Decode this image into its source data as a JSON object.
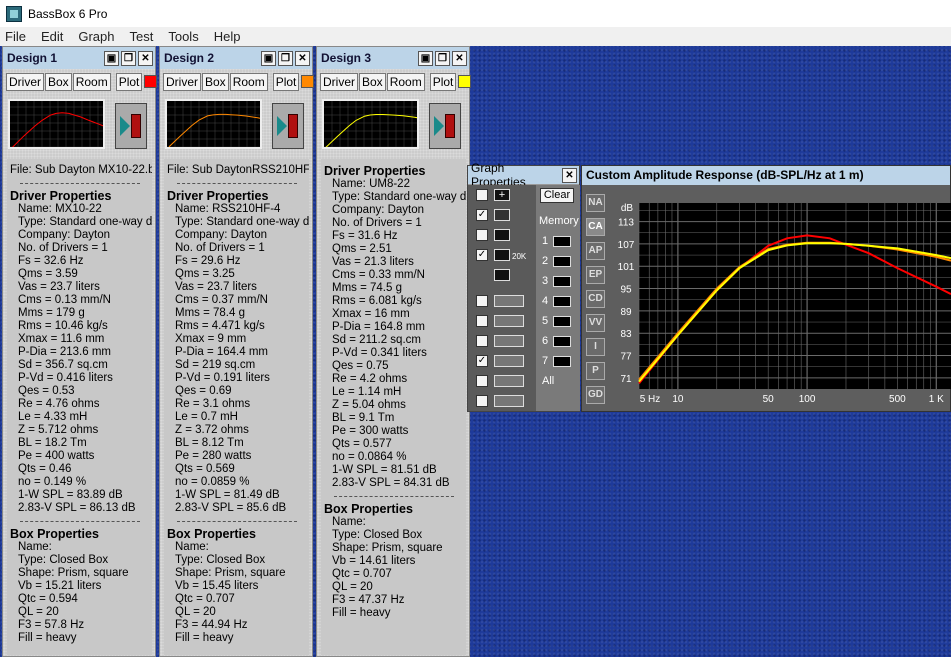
{
  "app": {
    "title": "BassBox 6 Pro"
  },
  "menu": [
    "File",
    "Edit",
    "Graph",
    "Test",
    "Tools",
    "Help"
  ],
  "tabs": {
    "driver": "Driver",
    "box": "Box",
    "room": "Room",
    "plot": "Plot"
  },
  "designs": [
    {
      "title": "Design 1",
      "color": "#ff0000",
      "file": "File: Sub Dayton MX10-22.bb6",
      "driver_heading": "Driver Properties",
      "driver": [
        "Name: MX10-22",
        "Type: Standard one-way driver",
        "Company: Dayton",
        "No. of Drivers = 1",
        "Fs = 32.6 Hz",
        "Qms = 3.59",
        "Vas = 23.7 liters",
        "Cms = 0.13 mm/N",
        "Mms = 179 g",
        "Rms = 10.46 kg/s",
        "Xmax = 11.6 mm",
        "P-Dia = 213.6 mm",
        "Sd = 356.7 sq.cm",
        "P-Vd = 0.416 liters",
        "Qes = 0.53",
        "Re = 4.76 ohms",
        "Le = 4.33 mH",
        "Z = 5.712 ohms",
        "BL = 18.2 Tm",
        "Pe = 400 watts",
        "Qts = 0.46",
        "no = 0.149 %",
        "1-W SPL = 83.89 dB",
        "2.83-V SPL = 86.13 dB"
      ],
      "box_heading": "Box Properties",
      "box": [
        "Name:",
        "Type: Closed Box",
        "Shape: Prism, square",
        "Vb = 15.21 liters",
        "Qtc = 0.594",
        "QL = 20",
        "F3 = 57.8 Hz",
        "Fill = heavy"
      ]
    },
    {
      "title": "Design 2",
      "color": "#ff8800",
      "file": "File: Sub DaytonRSS210HF-4.bb6",
      "driver_heading": "Driver Properties",
      "driver": [
        "Name: RSS210HF-4",
        "Type: Standard one-way driver",
        "Company: Dayton",
        "No. of Drivers = 1",
        "Fs = 29.6 Hz",
        "Qms = 3.25",
        "Vas = 23.7 liters",
        "Cms = 0.37 mm/N",
        "Mms = 78.4 g",
        "Rms = 4.471 kg/s",
        "Xmax = 9 mm",
        "P-Dia = 164.4 mm",
        "Sd = 219 sq.cm",
        "P-Vd = 0.191 liters",
        "Qes = 0.69",
        "Re = 3.1 ohms",
        "Le = 0.7 mH",
        "Z = 3.72 ohms",
        "BL = 8.12 Tm",
        "Pe = 280 watts",
        "Qts = 0.569",
        "no = 0.0859 %",
        "1-W SPL = 81.49 dB",
        "2.83-V SPL = 85.6 dB"
      ],
      "box_heading": "Box Properties",
      "box": [
        "Name:",
        "Type: Closed Box",
        "Shape: Prism, square",
        "Vb = 15.45 liters",
        "Qtc = 0.707",
        "QL = 20",
        "F3 = 44.94 Hz",
        "Fill = heavy"
      ]
    },
    {
      "title": "Design 3",
      "color": "#ffff00",
      "file": "",
      "driver_heading": "Driver Properties",
      "driver": [
        "Name: UM8-22",
        "Type: Standard one-way driver",
        "Company: Dayton",
        "No. of Drivers = 1",
        "Fs = 31.6 Hz",
        "Qms = 2.51",
        "Vas = 21.3 liters",
        "Cms = 0.33 mm/N",
        "Mms = 74.5 g",
        "Rms = 6.081 kg/s",
        "Xmax = 16 mm",
        "P-Dia = 164.8 mm",
        "Sd = 211.2 sq.cm",
        "P-Vd = 0.341 liters",
        "Qes = 0.75",
        "Re = 4.2 ohms",
        "Le = 1.14 mH",
        "Z = 5.04 ohms",
        "BL = 9.1 Tm",
        "Pe = 300 watts",
        "Qts = 0.577",
        "no = 0.0864 %",
        "1-W SPL = 81.51 dB",
        "2.83-V SPL = 84.31 dB"
      ],
      "box_heading": "Box Properties",
      "box": [
        "Name:",
        "Type: Closed Box",
        "Shape: Prism, square",
        "Vb = 14.61 liters",
        "Qtc = 0.707",
        "QL = 20",
        "F3 = 47.37 Hz",
        "Fill = heavy"
      ]
    }
  ],
  "graph_props": {
    "title": "Graph Properties",
    "clear": "Clear",
    "memory": "Memory",
    "slots": [
      "1",
      "2",
      "3",
      "4",
      "5",
      "6",
      "7"
    ],
    "all": "All",
    "icon_20k": "20K"
  },
  "side_buttons": [
    "NA",
    "CA",
    "AP",
    "EP",
    "CD",
    "VV",
    "I",
    "P",
    "GD"
  ],
  "chart_data": {
    "type": "line",
    "title": "Custom Amplitude Response (dB-SPL/Hz at 1 m)",
    "ylabel": "dB",
    "xscale": "log",
    "xlim": [
      5,
      1300
    ],
    "ylim": [
      68,
      118
    ],
    "yticks": [
      113,
      107,
      101,
      95,
      89,
      83,
      77,
      71
    ],
    "xticks": [
      {
        "v": 5,
        "l": "5 Hz"
      },
      {
        "v": 10,
        "l": "10"
      },
      {
        "v": 50,
        "l": "50"
      },
      {
        "v": 100,
        "l": "100"
      },
      {
        "v": 500,
        "l": "500"
      },
      {
        "v": 1000,
        "l": "1 K"
      }
    ],
    "grid": true,
    "series": [
      {
        "color": "#ff0000",
        "x": [
          5,
          10,
          20,
          30,
          50,
          70,
          100,
          150,
          200,
          300,
          500,
          1000,
          1300
        ],
        "y": [
          69.5,
          82.5,
          94.5,
          100.5,
          106.5,
          108.5,
          109.3,
          108.5,
          106.8,
          104.5,
          100.5,
          95.5,
          93.5
        ]
      },
      {
        "color": "#ff8800",
        "x": [
          5,
          10,
          20,
          30,
          50,
          70,
          100,
          150,
          200,
          300,
          500,
          1000,
          1300
        ],
        "y": [
          70.5,
          83,
          95,
          100.8,
          105.6,
          106.8,
          107.3,
          107.3,
          107,
          106.5,
          105.5,
          103.5,
          102.5
        ]
      },
      {
        "color": "#ffff00",
        "x": [
          5,
          10,
          20,
          30,
          50,
          70,
          100,
          150,
          200,
          300,
          500,
          1000,
          1300
        ],
        "y": [
          70,
          82.5,
          94.5,
          100.5,
          105.3,
          106.6,
          107.2,
          107.2,
          107,
          106.5,
          105.8,
          104,
          103.2
        ]
      }
    ]
  }
}
